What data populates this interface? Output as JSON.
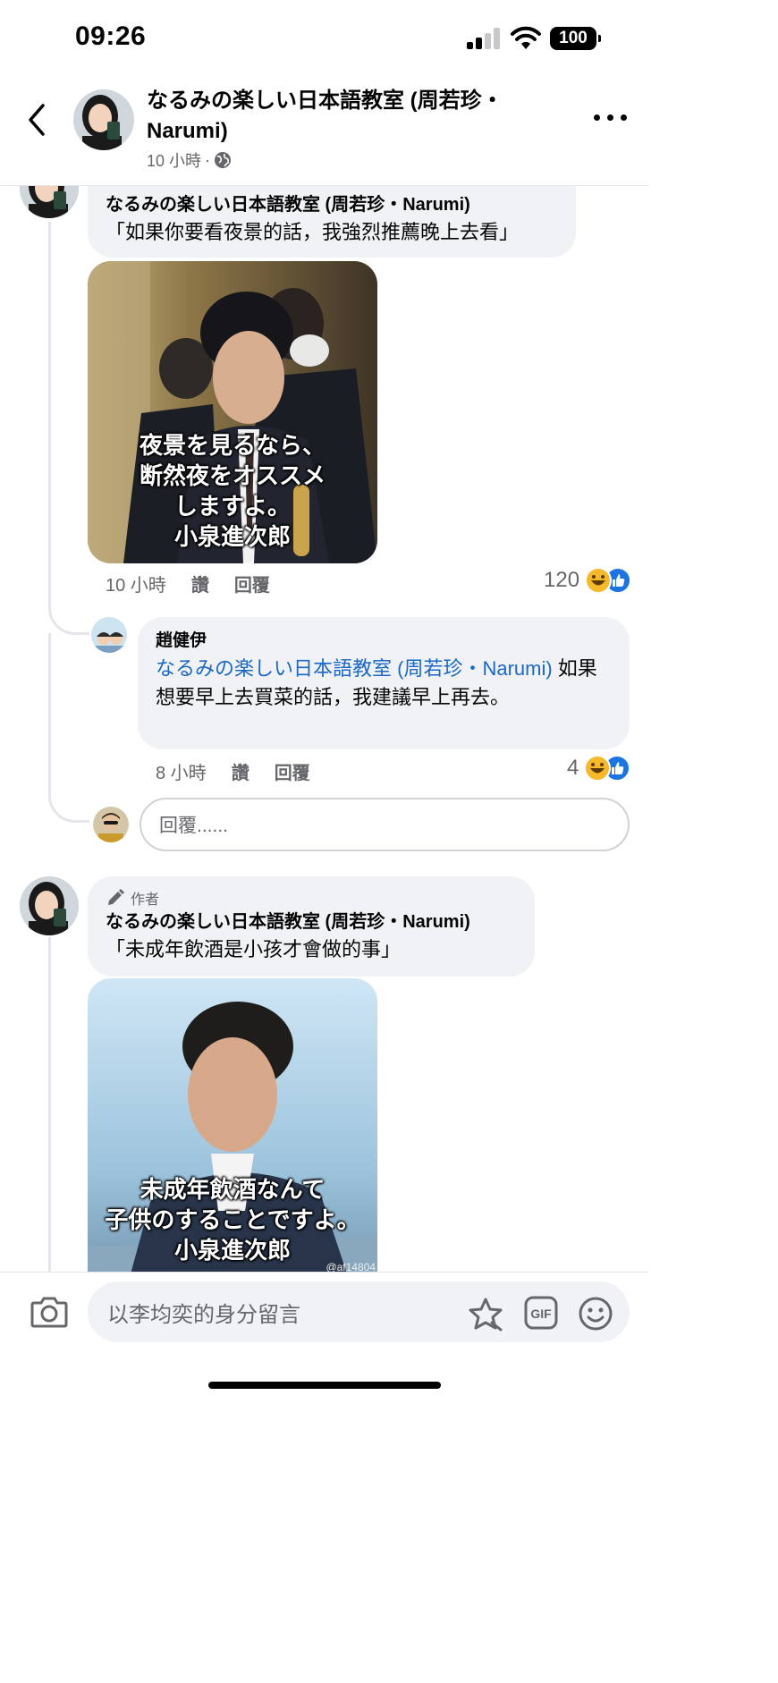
{
  "status_bar": {
    "time": "09:26",
    "battery": "100"
  },
  "header": {
    "title": "なるみの楽しい日本語教室 (周若珍・Narumi)",
    "meta_time": "10 小時",
    "meta_dot": "·"
  },
  "comments": [
    {
      "author": "なるみの楽しい日本語教室 (周若珍・Narumi)",
      "text": "「如果你要看夜景的話，我強烈推薦晚上去看」",
      "image_caption": [
        "夜景を見るなら、",
        "断然夜をオススメ",
        "しますよ。",
        "小泉進次郎"
      ],
      "time": "10 小時",
      "like_label": "讚",
      "reply_label": "回覆",
      "reaction_count": "120",
      "reply": {
        "author": "趙健伊",
        "mention": "なるみの楽しい日本語教室 (周若珍・Narumi)",
        "text": "如果想要早上去買菜的話，我建議早上再去。",
        "time": "8 小時",
        "like_label": "讚",
        "reply_label": "回覆",
        "reaction_count": "4"
      },
      "reply_placeholder": "回覆......"
    },
    {
      "author_badge": "作者",
      "author": "なるみの楽しい日本語教室 (周若珍・Narumi)",
      "text": "「未成年飲酒是小孩才會做的事」",
      "image_caption": [
        "未成年飲酒なんて",
        "子供のすることですよ。",
        "小泉進次郎"
      ],
      "image_watermark": "@af14804"
    }
  ],
  "composer": {
    "placeholder": "以李均奕的身分留言",
    "gif_label": "GIF"
  }
}
